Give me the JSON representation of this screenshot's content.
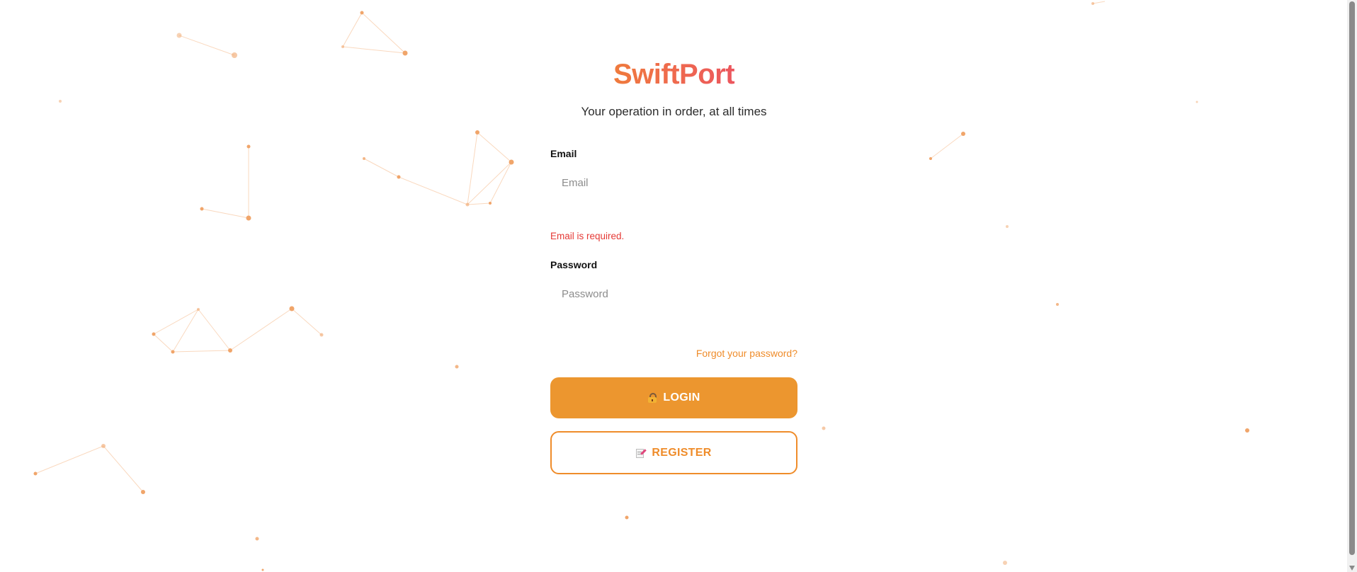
{
  "app": {
    "brand": "SwiftPort",
    "tagline": "Your operation in order, at all times"
  },
  "form": {
    "email": {
      "label": "Email",
      "placeholder": "Email",
      "value": "",
      "error": "Email is required."
    },
    "password": {
      "label": "Password",
      "placeholder": "Password",
      "value": ""
    },
    "forgot_link": "Forgot your password?",
    "login_button": "LOGIN",
    "register_button": "REGISTER"
  },
  "icons": {
    "login": "lock-icon",
    "register": "memo-icon"
  },
  "colors": {
    "accent": "#ec962f",
    "brand_gradient_start": "#ef8c2a",
    "brand_gradient_end": "#e8416e",
    "error": "#e53935",
    "particles": "#f0a56a"
  }
}
